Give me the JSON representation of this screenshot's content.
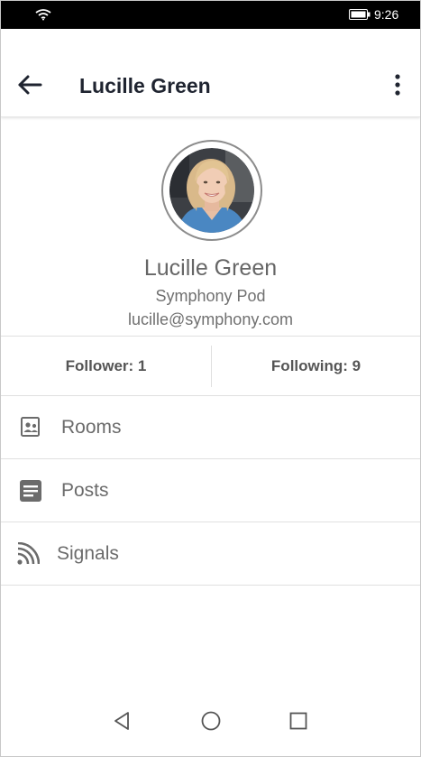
{
  "status_bar": {
    "time": "9:26",
    "wifi_icon": "wifi-icon",
    "battery_icon": "battery-icon"
  },
  "app_bar": {
    "title": "Lucille Green",
    "back_icon": "arrow-back-icon",
    "more_icon": "more-vert-icon"
  },
  "profile": {
    "name": "Lucille Green",
    "company": "Symphony Pod",
    "email": "lucille@symphony.com",
    "avatar_alt": "profile photo"
  },
  "stats": {
    "follower": "Follower: 1",
    "following": "Following: 9"
  },
  "menu": [
    {
      "label": "Rooms",
      "icon": "rooms-icon"
    },
    {
      "label": "Posts",
      "icon": "posts-icon"
    },
    {
      "label": "Signals",
      "icon": "signals-icon"
    }
  ],
  "nav_bar": {
    "back": "nav-back-icon",
    "home": "nav-home-icon",
    "recents": "nav-recents-icon"
  },
  "colors": {
    "status_bar": "#000000",
    "title_text": "#1f2430",
    "icon_gray": "#6b6b6b",
    "divider": "#e0e0e0"
  }
}
